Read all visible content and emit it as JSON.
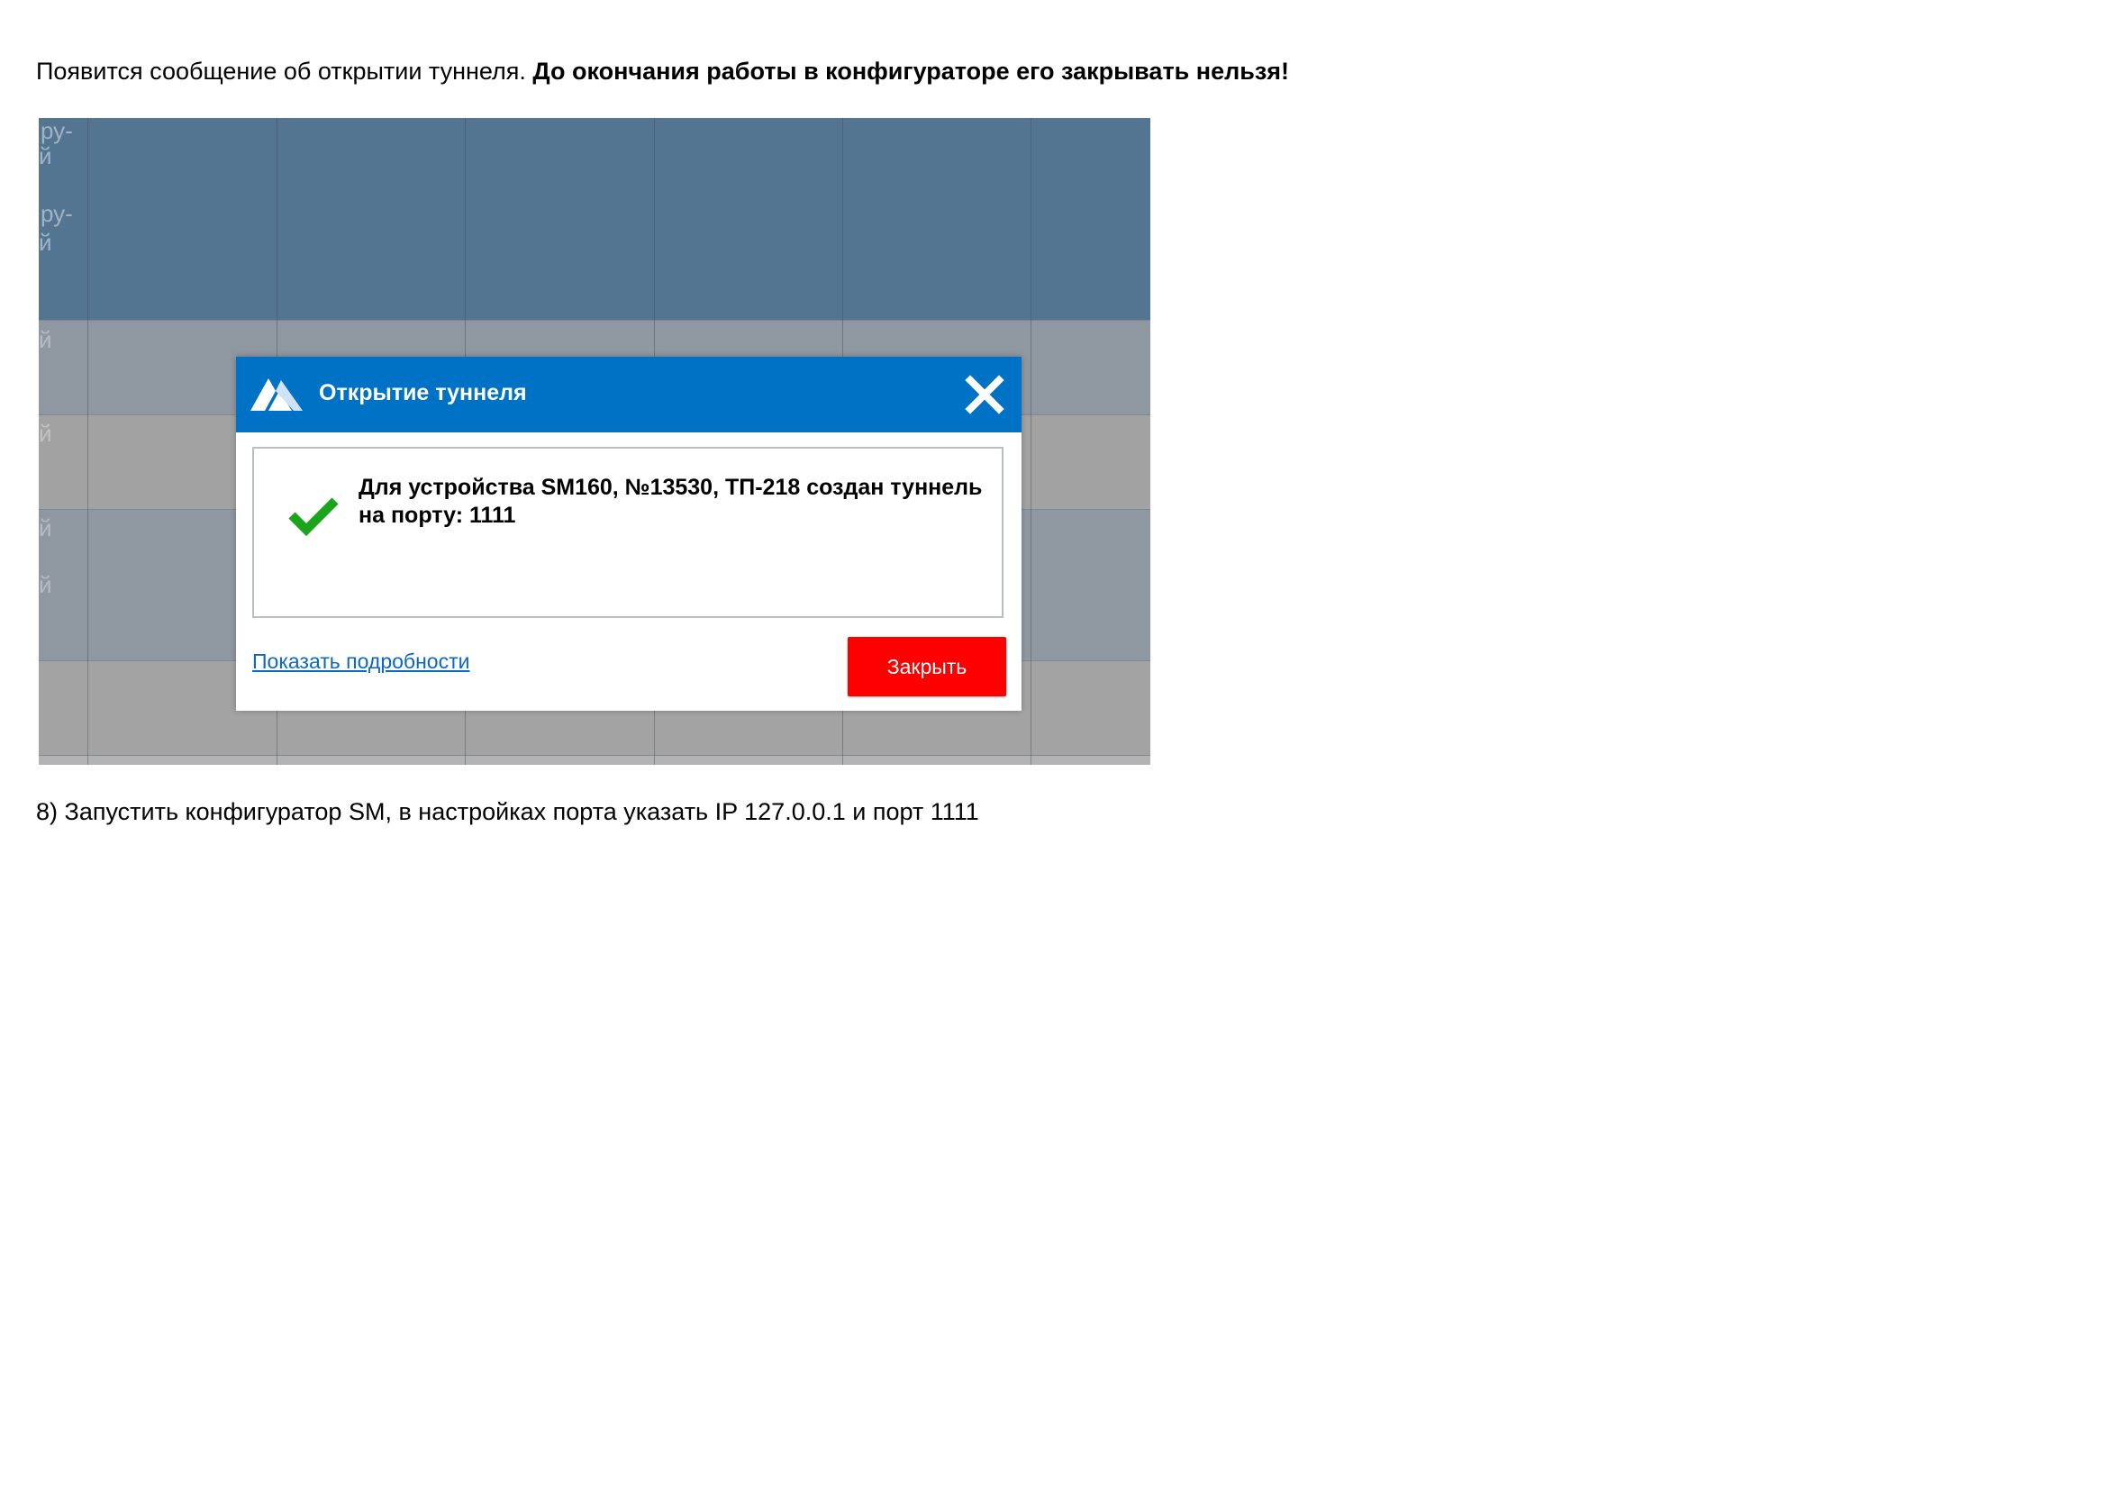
{
  "document": {
    "line1_regular": "Появится сообщение об открытии туннеля. ",
    "line1_bold": "До окончания работы в конфигураторе его закрывать нельзя!",
    "line2": "8) Запустить конфигуратор SM, в настройках порта указать IP 127.0.0.1 и порт 1111"
  },
  "screenshot": {
    "background_cells": [
      "ру-",
      "й",
      "ру-",
      "й",
      "й",
      "й",
      "й",
      "й"
    ],
    "header_color": "#537591",
    "row_colors": [
      "#8f97a1",
      "#a2a2a2",
      "#8f97a1",
      "#a3a3a3"
    ]
  },
  "dialog": {
    "title": "Открытие туннеля",
    "logo_icon": "mountain-logo-icon",
    "close_icon": "close-icon",
    "status_icon": "checkmark-icon",
    "message": "Для устройства SM160, №13530, ТП-218 создан туннель на порту: 1111",
    "details_link": "Показать подробности",
    "close_button": "Закрыть",
    "colors": {
      "titlebar": "#0072c6",
      "close_button": "#ff0000",
      "check": "#1aa51a",
      "link": "#0a68c4"
    }
  }
}
